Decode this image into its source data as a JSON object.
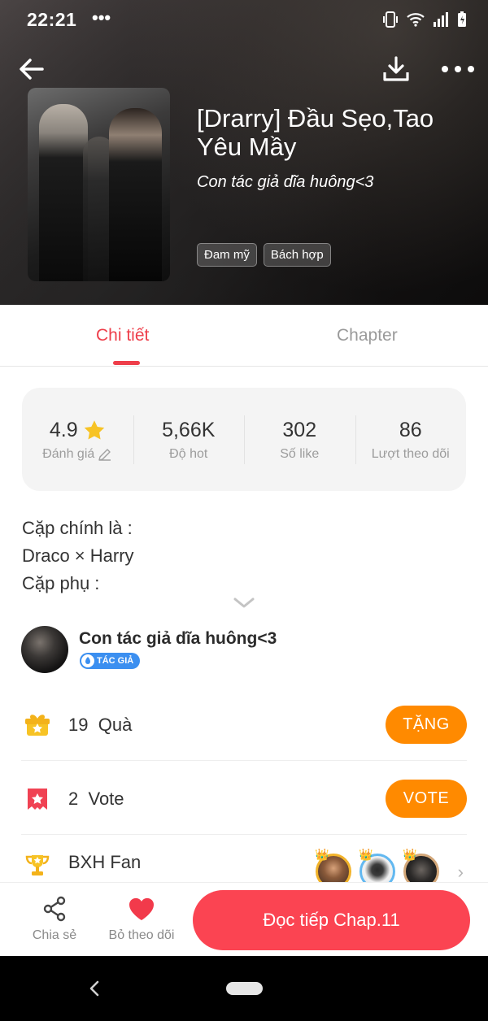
{
  "status_bar": {
    "time": "22:21",
    "dots": "•••",
    "icons": [
      "vibrate-icon",
      "wifi-icon",
      "signal-icon",
      "battery-icon"
    ]
  },
  "header": {
    "title": "[Drarry] Đầu Sẹo,Tao Yêu Mầy",
    "author": "Con tác giả dĩa huông<3",
    "tags": [
      "Đam mỹ",
      "Bách hợp"
    ],
    "icons": [
      "back-arrow-icon",
      "download-icon",
      "more-icon"
    ]
  },
  "tabs": {
    "detail": "Chi tiết",
    "chapter": "Chapter",
    "active_color": "#ee3e4a"
  },
  "stats": {
    "rating_value": "4.9",
    "rating_label": "Đánh giá",
    "hot_value": "5,66K",
    "hot_label": "Độ hot",
    "like_value": "302",
    "like_label": "Số like",
    "follow_value": "86",
    "follow_label": "Lượt theo dõi"
  },
  "description": {
    "line1": "Cặp chính là :",
    "line2": "Draco × Harry",
    "line3": "Cặp phụ :"
  },
  "author": {
    "name": "Con tác giả dĩa huông<3",
    "badge": "TÁC GIẢ"
  },
  "gifts": {
    "count": "19",
    "label": "Quà",
    "button": "TẶNG"
  },
  "votes": {
    "count": "2",
    "label": "Vote",
    "button": "VOTE"
  },
  "fan_ranking": {
    "label": "BXH Fan"
  },
  "bottom_bar": {
    "share_label": "Chia sẻ",
    "unfollow_label": "Bỏ theo dõi",
    "read_button": "Đọc tiếp Chap.11",
    "read_color": "#fb4452"
  },
  "colors": {
    "accent": "#ee3e4a",
    "orange": "#ff8a00"
  }
}
